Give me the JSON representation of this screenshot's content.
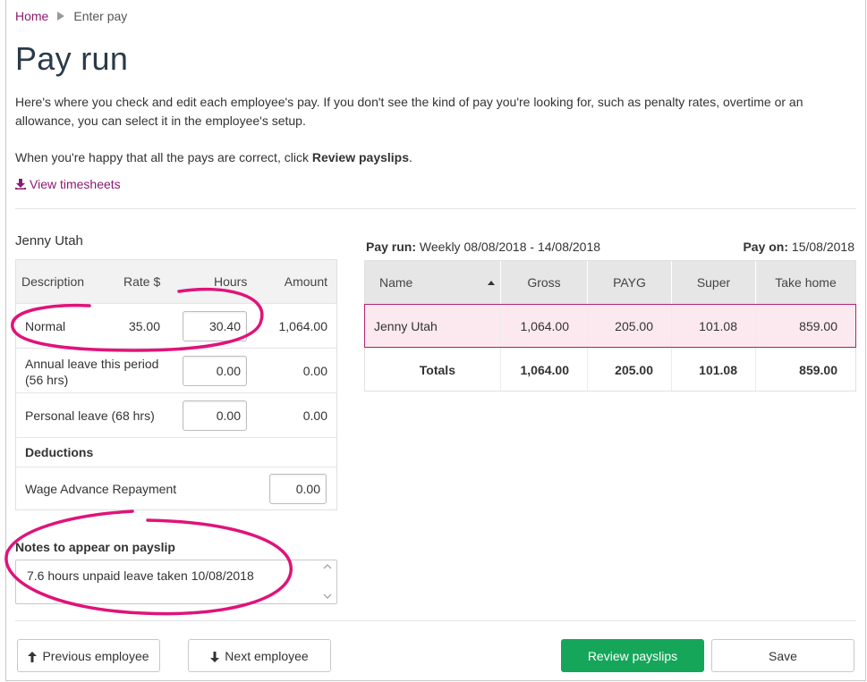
{
  "breadcrumb": {
    "home": "Home",
    "current": "Enter pay"
  },
  "title": "Pay run",
  "intro": {
    "paragraph1": "Here's where you check and edit each employee's pay. If you don't see the kind of pay you're looking for, such as penalty rates, overtime or an allowance, you can select it in the employee's setup.",
    "paragraph2_prefix": "When you're happy that all the pays are correct, click ",
    "paragraph2_bold": "Review payslips",
    "paragraph2_suffix": "."
  },
  "view_timesheets": "View timesheets",
  "employee": {
    "name": "Jenny Utah",
    "table": {
      "headers": {
        "description": "Description",
        "rate": "Rate $",
        "hours": "Hours",
        "amount": "Amount"
      },
      "rows": [
        {
          "description": "Normal",
          "rate": "35.00",
          "hours": "30.40",
          "amount": "1,064.00"
        },
        {
          "description_line1": "Annual leave this period",
          "description_line2": "(56 hrs)",
          "hours": "0.00",
          "amount": "0.00"
        },
        {
          "description": "Personal leave (68 hrs)",
          "hours": "0.00",
          "amount": "0.00"
        }
      ],
      "deductions_label": "Deductions",
      "deductions": [
        {
          "description": "Wage Advance Repayment",
          "amount": "0.00"
        }
      ]
    }
  },
  "notes": {
    "label": "Notes to appear on payslip",
    "value": "7.6 hours unpaid leave taken 10/08/2018"
  },
  "summary": {
    "pay_run_label": "Pay run:",
    "pay_run_value": "Weekly 08/08/2018 - 14/08/2018",
    "pay_on_label": "Pay on:",
    "pay_on_value": "15/08/2018",
    "headers": [
      "Name",
      "Gross",
      "PAYG",
      "Super",
      "Take home"
    ],
    "row": {
      "name": "Jenny Utah",
      "gross": "1,064.00",
      "payg": "205.00",
      "super": "101.08",
      "take_home": "859.00"
    },
    "totals": {
      "label": "Totals",
      "gross": "1,064.00",
      "payg": "205.00",
      "super": "101.08",
      "take_home": "859.00"
    }
  },
  "buttons": {
    "previous": "Previous employee",
    "next": "Next employee",
    "review": "Review payslips",
    "save": "Save"
  },
  "colors": {
    "accent": "#8a1a73",
    "primary_button": "#15a65a",
    "highlight": "#e0137a"
  }
}
